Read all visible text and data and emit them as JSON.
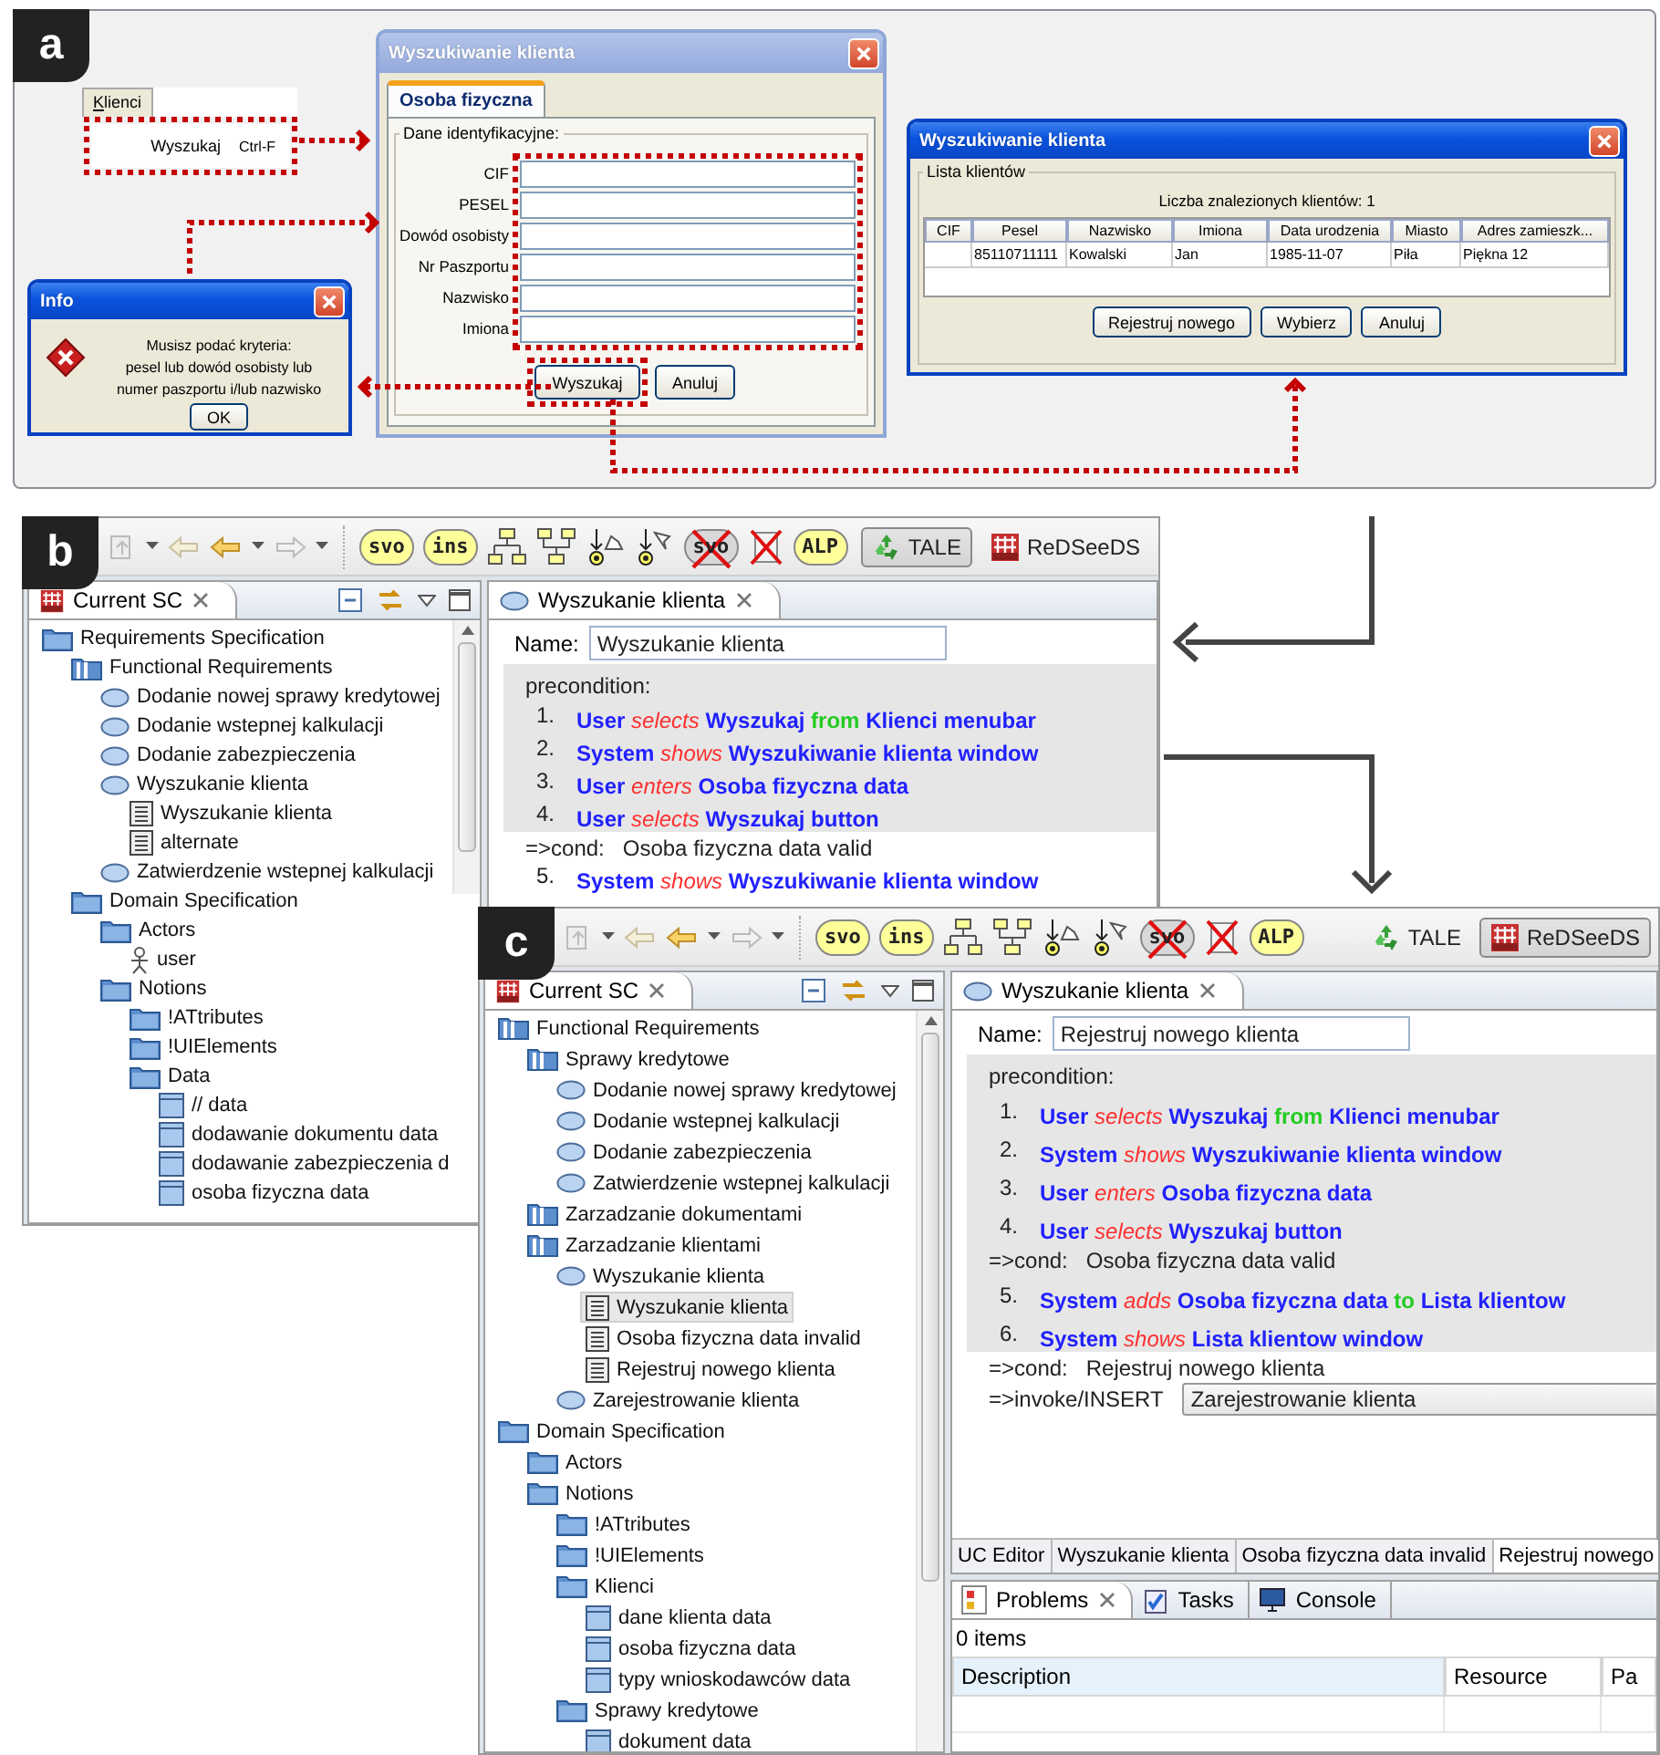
{
  "panel_a": {
    "label": "a",
    "menu": {
      "title": "Klienci",
      "item": "Wyszukaj",
      "shortcut": "Ctrl-F"
    },
    "search_dialog": {
      "title": "Wyszukiwanie klienta",
      "tabs": [
        {
          "label": "Osoba fizyczna",
          "selected": true
        }
      ],
      "group": "Dane identyfikacyjne:",
      "fields": [
        "CIF",
        "PESEL",
        "Dowód osobisty",
        "Nr Paszportu",
        "Nazwisko",
        "Imiona"
      ],
      "buttons": [
        "Wyszukaj",
        "Anuluj"
      ]
    },
    "info_dialog": {
      "title": "Info",
      "message": [
        "Musisz podać kryteria:",
        "pesel lub dowód osobisty lub",
        "numer paszportu i/lub nazwisko"
      ],
      "button": "OK"
    },
    "results_dialog": {
      "title": "Wyszukiwanie klienta",
      "group": "Lista klientów",
      "count": "Liczba znalezionych klientów:  1",
      "columns": [
        "CIF",
        "Pesel",
        "Nazwisko",
        "Imiona",
        "Data urodzenia",
        "Miasto",
        "Adres zamieszk..."
      ],
      "rows": [
        [
          null,
          "85110711111",
          "Kowalski",
          "Jan",
          "1985-11-07",
          "Piła",
          "Piękna 12"
        ]
      ],
      "buttons": [
        "Rejestruj nowego",
        "Wybierz",
        "Anuluj"
      ]
    }
  },
  "panel_b": {
    "label": "b",
    "toolbar": [
      {
        "kind": "badge",
        "label": "svo"
      },
      {
        "kind": "badge",
        "label": "ins"
      },
      {
        "kind": "split"
      },
      {
        "kind": "merge"
      },
      {
        "kind": "pre"
      },
      {
        "kind": "post"
      },
      {
        "kind": "crossed-badge",
        "label": "svo"
      },
      {
        "kind": "crossed-box"
      },
      {
        "kind": "badge",
        "label": "ALP"
      }
    ],
    "perspectives": [
      {
        "label": "TALE",
        "selected": true
      },
      {
        "label": "ReDSeeDS",
        "selected": false
      }
    ],
    "tree_view": {
      "title": "Current SC",
      "tree": [
        {
          "label": "Requirements Specification",
          "kind": "folder",
          "selected": false,
          "children": [
            {
              "label": "Functional Requirements",
              "kind": "package",
              "selected": false,
              "children": [
                {
                  "label": "Dodanie nowej sprawy kredytowej",
                  "kind": "usecase",
                  "selected": false
                },
                {
                  "label": "Dodanie wstepnej kalkulacji",
                  "kind": "usecase",
                  "selected": false
                },
                {
                  "label": "Dodanie zabezpieczenia",
                  "kind": "usecase",
                  "selected": false
                },
                {
                  "label": "Wyszukanie klienta",
                  "kind": "usecase",
                  "selected": false,
                  "children": [
                    {
                      "label": "Wyszukanie klienta",
                      "kind": "scenario",
                      "selected": false
                    },
                    {
                      "label": "alternate",
                      "kind": "scenario",
                      "selected": false
                    }
                  ]
                },
                {
                  "label": "Zatwierdzenie wstepnej kalkulacji",
                  "kind": "usecase",
                  "selected": false
                }
              ]
            },
            {
              "label": "Domain Specification",
              "kind": "folder",
              "selected": false,
              "children": [
                {
                  "label": "Actors",
                  "kind": "folder",
                  "selected": false,
                  "children": [
                    {
                      "label": "user",
                      "kind": "actor",
                      "selected": false
                    }
                  ]
                },
                {
                  "label": "Notions",
                  "kind": "folder",
                  "selected": false,
                  "children": [
                    {
                      "label": "!ATtributes",
                      "kind": "folder",
                      "selected": false
                    },
                    {
                      "label": "!UIElements",
                      "kind": "folder",
                      "selected": false
                    },
                    {
                      "label": "Data",
                      "kind": "folder",
                      "selected": false,
                      "children": [
                        {
                          "label": "//  data",
                          "kind": "notion",
                          "selected": false
                        },
                        {
                          "label": "dodawanie dokumentu data",
                          "kind": "notion",
                          "selected": false
                        },
                        {
                          "label": "dodawanie zabezpieczenia d",
                          "kind": "notion",
                          "selected": false
                        },
                        {
                          "label": "osoba fizyczna data",
                          "kind": "notion",
                          "selected": false
                        }
                      ]
                    }
                  ]
                }
              ]
            }
          ]
        }
      ]
    },
    "editor": {
      "tab": "Wyszukanie klienta",
      "name_label": "Name:",
      "name": "Wyszukanie klienta",
      "lines": [
        {
          "kind": "label",
          "shaded": true,
          "text": "precondition:"
        },
        {
          "kind": "step",
          "shaded": true,
          "number": "1.",
          "parts": [
            {
              "kind": "actor",
              "text": "User"
            },
            {
              "kind": "verb",
              "text": "selects"
            },
            {
              "kind": "object",
              "text": "Wyszukaj"
            },
            {
              "kind": "prep",
              "text": "from"
            },
            {
              "kind": "object",
              "text": "Klienci menubar"
            }
          ]
        },
        {
          "kind": "step",
          "shaded": true,
          "number": "2.",
          "parts": [
            {
              "kind": "actor",
              "text": "System"
            },
            {
              "kind": "verb",
              "text": "shows"
            },
            {
              "kind": "object",
              "text": "Wyszukiwanie klienta window"
            }
          ]
        },
        {
          "kind": "step",
          "shaded": true,
          "number": "3.",
          "parts": [
            {
              "kind": "actor",
              "text": "User"
            },
            {
              "kind": "verb",
              "text": "enters"
            },
            {
              "kind": "object",
              "text": "Osoba fizyczna data"
            }
          ]
        },
        {
          "kind": "step",
          "shaded": true,
          "number": "4.",
          "parts": [
            {
              "kind": "actor",
              "text": "User"
            },
            {
              "kind": "verb",
              "text": "selects"
            },
            {
              "kind": "object",
              "text": "Wyszukaj button"
            }
          ]
        },
        {
          "kind": "cond",
          "shaded": false,
          "keyword": "=>cond:",
          "text": "Osoba fizyczna data valid"
        },
        {
          "kind": "step",
          "shaded": false,
          "number": "5.",
          "parts": [
            {
              "kind": "actor",
              "text": "System"
            },
            {
              "kind": "verb",
              "text": "shows"
            },
            {
              "kind": "object",
              "text": "Wyszukiwanie klienta window"
            }
          ]
        }
      ]
    }
  },
  "panel_c": {
    "label": "c",
    "toolbar": [
      {
        "kind": "badge",
        "label": "svo"
      },
      {
        "kind": "badge",
        "label": "ins"
      },
      {
        "kind": "split"
      },
      {
        "kind": "merge"
      },
      {
        "kind": "pre"
      },
      {
        "kind": "post"
      },
      {
        "kind": "crossed-badge",
        "label": "svo"
      },
      {
        "kind": "crossed-box"
      },
      {
        "kind": "badge",
        "label": "ALP"
      }
    ],
    "perspectives": [
      {
        "label": "TALE",
        "selected": false
      },
      {
        "label": "ReDSeeDS",
        "selected": true
      }
    ],
    "tree_view": {
      "title": "Current SC",
      "tree": [
        {
          "label": "Functional Requirements",
          "kind": "package",
          "selected": false,
          "children": [
            {
              "label": "Sprawy kredytowe",
              "kind": "package",
              "selected": false,
              "children": [
                {
                  "label": "Dodanie nowej sprawy kredytowej",
                  "kind": "usecase",
                  "selected": false
                },
                {
                  "label": "Dodanie wstepnej kalkulacji",
                  "kind": "usecase",
                  "selected": false
                },
                {
                  "label": "Dodanie zabezpieczenia",
                  "kind": "usecase",
                  "selected": false
                },
                {
                  "label": "Zatwierdzenie wstepnej kalkulacji",
                  "kind": "usecase",
                  "selected": false
                }
              ]
            },
            {
              "label": "Zarzadzanie dokumentami",
              "kind": "package",
              "selected": false
            },
            {
              "label": "Zarzadzanie klientami",
              "kind": "package",
              "selected": false,
              "children": [
                {
                  "label": "Wyszukanie klienta",
                  "kind": "usecase",
                  "selected": false,
                  "children": [
                    {
                      "label": "Wyszukanie klienta",
                      "kind": "scenario",
                      "selected": true
                    },
                    {
                      "label": "Osoba fizyczna data invalid",
                      "kind": "scenario",
                      "selected": false
                    },
                    {
                      "label": "Rejestruj nowego klienta",
                      "kind": "scenario",
                      "selected": false
                    }
                  ]
                },
                {
                  "label": "Zarejestrowanie klienta",
                  "kind": "usecase",
                  "selected": false
                }
              ]
            }
          ]
        },
        {
          "label": "Domain Specification",
          "kind": "folder",
          "selected": false,
          "children": [
            {
              "label": "Actors",
              "kind": "folder",
              "selected": false
            },
            {
              "label": "Notions",
              "kind": "folder",
              "selected": false,
              "children": [
                {
                  "label": "!ATtributes",
                  "kind": "folder",
                  "selected": false
                },
                {
                  "label": "!UIElements",
                  "kind": "folder",
                  "selected": false
                },
                {
                  "label": "Klienci",
                  "kind": "folder",
                  "selected": false,
                  "children": [
                    {
                      "label": "dane klienta data",
                      "kind": "notion",
                      "selected": false
                    },
                    {
                      "label": "osoba fizyczna data",
                      "kind": "notion",
                      "selected": false
                    },
                    {
                      "label": "typy wnioskodawców data",
                      "kind": "notion",
                      "selected": false
                    }
                  ]
                },
                {
                  "label": "Sprawy kredytowe",
                  "kind": "folder",
                  "selected": false,
                  "children": [
                    {
                      "label": "dokument data",
                      "kind": "notion",
                      "selected": false
                    }
                  ]
                }
              ]
            }
          ]
        }
      ]
    },
    "editor": {
      "tab": "Wyszukanie klienta",
      "name_label": "Name:",
      "name": "Rejestruj nowego klienta",
      "lines": [
        {
          "kind": "label",
          "shaded": true,
          "text": "precondition:"
        },
        {
          "kind": "step",
          "shaded": true,
          "number": "1.",
          "parts": [
            {
              "kind": "actor",
              "text": "User"
            },
            {
              "kind": "verb",
              "text": "selects"
            },
            {
              "kind": "object",
              "text": "Wyszukaj"
            },
            {
              "kind": "prep",
              "text": "from"
            },
            {
              "kind": "object",
              "text": "Klienci menubar"
            }
          ]
        },
        {
          "kind": "step",
          "shaded": true,
          "number": "2.",
          "parts": [
            {
              "kind": "actor",
              "text": "System"
            },
            {
              "kind": "verb",
              "text": "shows"
            },
            {
              "kind": "object",
              "text": "Wyszukiwanie klienta window"
            }
          ]
        },
        {
          "kind": "step",
          "shaded": true,
          "number": "3.",
          "parts": [
            {
              "kind": "actor",
              "text": "User"
            },
            {
              "kind": "verb",
              "text": "enters"
            },
            {
              "kind": "object",
              "text": "Osoba fizyczna data"
            }
          ]
        },
        {
          "kind": "step",
          "shaded": true,
          "number": "4.",
          "parts": [
            {
              "kind": "actor",
              "text": "User"
            },
            {
              "kind": "verb",
              "text": "selects"
            },
            {
              "kind": "object",
              "text": "Wyszukaj button"
            }
          ]
        },
        {
          "kind": "cond",
          "shaded": true,
          "keyword": "=>cond:",
          "text": "Osoba fizyczna data valid"
        },
        {
          "kind": "step",
          "shaded": true,
          "number": "5.",
          "parts": [
            {
              "kind": "actor",
              "text": "System"
            },
            {
              "kind": "verb",
              "text": "adds"
            },
            {
              "kind": "object",
              "text": "Osoba fizyczna data"
            },
            {
              "kind": "prep",
              "text": "to"
            },
            {
              "kind": "object",
              "text": "Lista klientow"
            }
          ]
        },
        {
          "kind": "step",
          "shaded": true,
          "number": "6.",
          "parts": [
            {
              "kind": "actor",
              "text": "System"
            },
            {
              "kind": "verb",
              "text": "shows"
            },
            {
              "kind": "object",
              "text": "Lista klientow window"
            }
          ]
        },
        {
          "kind": "cond",
          "shaded": false,
          "keyword": "=>cond:",
          "text": "Rejestruj nowego klienta"
        },
        {
          "kind": "invoke",
          "shaded": false,
          "keyword": "=>invoke/INSERT",
          "value": "Zarejestrowanie klienta"
        }
      ],
      "pages": [
        {
          "label": "UC Editor",
          "selected": false
        },
        {
          "label": "Wyszukanie klienta",
          "selected": false
        },
        {
          "label": "Osoba fizyczna data invalid",
          "selected": false
        },
        {
          "label": "Rejestruj nowego",
          "selected": true
        }
      ]
    },
    "problems": {
      "tabs": [
        {
          "label": "Problems",
          "selected": true
        },
        {
          "label": "Tasks",
          "selected": false
        },
        {
          "label": "Console",
          "selected": false
        }
      ],
      "status": "0 items",
      "columns": [
        "Description",
        "Resource",
        "Pa"
      ]
    }
  }
}
